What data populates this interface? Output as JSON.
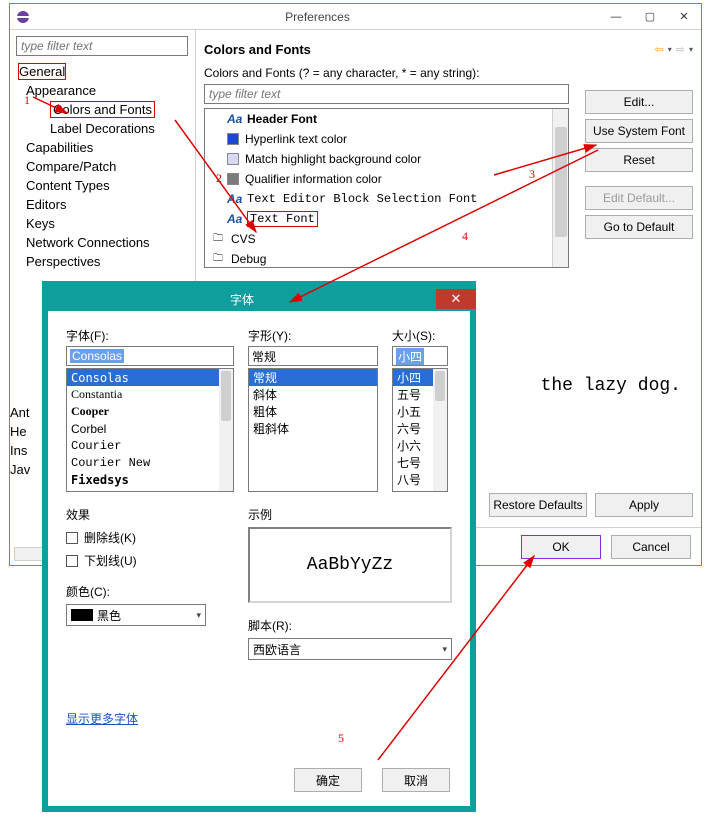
{
  "window": {
    "title": "Preferences",
    "filter_placeholder": "type filter text"
  },
  "nav": {
    "general": "General",
    "appearance": "Appearance",
    "colors_fonts": "Colors and Fonts",
    "label_dec": "Label Decorations",
    "capabilities": "Capabilities",
    "compare": "Compare/Patch",
    "content_types": "Content Types",
    "editors": "Editors",
    "keys": "Keys",
    "network": "Network Connections",
    "perspectives": "Perspectives"
  },
  "edgecol": [
    "Ant",
    "He",
    "Ins",
    "Jav"
  ],
  "rpane": {
    "title": "Colors and Fonts",
    "prompt": "Colors and Fonts (? = any character, * = any string):",
    "filter2_placeholder": "type filter text",
    "items": [
      {
        "kind": "font",
        "label": "Header Font",
        "bold": true
      },
      {
        "kind": "swatch",
        "color": "#1a47d6",
        "label": "Hyperlink text color"
      },
      {
        "kind": "swatch",
        "color": "#d7d7f6",
        "label": "Match highlight background color"
      },
      {
        "kind": "swatch",
        "color": "#7a7a7a",
        "label": "Qualifier information color"
      },
      {
        "kind": "font",
        "label": "Text Editor Block Selection Font",
        "mono": true
      },
      {
        "kind": "font",
        "label": "Text Font",
        "mono": true,
        "highlight": true
      },
      {
        "kind": "cfg",
        "label": "CVS"
      },
      {
        "kind": "cfg",
        "label": "Debug"
      }
    ],
    "btns": {
      "edit": "Edit...",
      "use_sys": "Use System Font",
      "reset": "Reset",
      "edit_def": "Edit Default...",
      "go_def": "Go to Default"
    },
    "preview_fragment": "the lazy dog.",
    "restore": "Restore Defaults",
    "apply": "Apply",
    "ok": "OK",
    "cancel": "Cancel"
  },
  "fontdlg": {
    "title": "字体",
    "font_label": "字体(F):",
    "style_label": "字形(Y):",
    "size_label": "大小(S):",
    "font_value": "Consolas",
    "style_value": "常规",
    "size_value": "小四",
    "fonts": [
      "Consolas",
      "Constantia",
      "Cooper",
      "Corbel",
      "Courier",
      "Courier New",
      "Fixedsys"
    ],
    "styles": [
      "常规",
      "斜体",
      "粗体",
      "粗斜体"
    ],
    "sizes": [
      "小四",
      "五号",
      "小五",
      "六号",
      "小六",
      "七号",
      "八号"
    ],
    "effects_label": "效果",
    "strike": "删除线(K)",
    "underline": "下划线(U)",
    "color_label": "颜色(C):",
    "color_value": "黑色",
    "sample_label": "示例",
    "sample_text": "AaBbYyZz",
    "script_label": "脚本(R):",
    "script_value": "西欧语言",
    "more_fonts": "显示更多字体",
    "ok": "确定",
    "cancel": "取消"
  },
  "anno": {
    "n1": "1",
    "n2": "2",
    "n3": "3",
    "n4": "4",
    "n5": "5"
  }
}
